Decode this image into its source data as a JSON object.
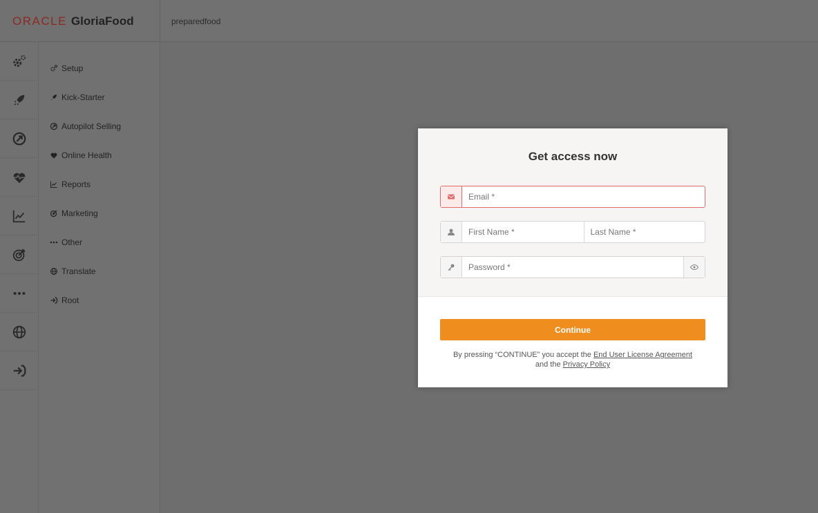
{
  "header": {
    "brand_oracle": "ORACLE",
    "brand_gloria": "GloriaFood",
    "restaurant_name": "preparedfood"
  },
  "icon_rail": [
    {
      "icon": "gears-icon"
    },
    {
      "icon": "rocket-icon"
    },
    {
      "icon": "autopilot-icon"
    },
    {
      "icon": "heart-pulse-icon"
    },
    {
      "icon": "chart-line-icon"
    },
    {
      "icon": "target-icon"
    },
    {
      "icon": "more-dots-icon"
    },
    {
      "icon": "globe-icon"
    },
    {
      "icon": "sign-in-icon"
    }
  ],
  "menu": {
    "items": [
      {
        "label": "Setup",
        "icon": "gears-icon"
      },
      {
        "label": "Kick-Starter",
        "icon": "rocket-icon"
      },
      {
        "label": "Autopilot Selling",
        "icon": "autopilot-icon"
      },
      {
        "label": "Online Health",
        "icon": "heart-pulse-icon"
      },
      {
        "label": "Reports",
        "icon": "chart-line-icon"
      },
      {
        "label": "Marketing",
        "icon": "target-icon"
      },
      {
        "label": "Other",
        "icon": "more-dots-icon"
      },
      {
        "label": "Translate",
        "icon": "globe-icon"
      },
      {
        "label": "Root",
        "icon": "sign-in-icon"
      }
    ]
  },
  "modal": {
    "title": "Get access now",
    "email_placeholder": "Email *",
    "email_value": "",
    "first_name_placeholder": "First Name *",
    "first_name_value": "",
    "last_name_placeholder": "Last Name *",
    "last_name_value": "",
    "password_placeholder": "Password *",
    "password_value": "",
    "continue_label": "Continue",
    "legal_prefix": "By pressing “CONTINUE” you accept the ",
    "eula_link": "End User License Agreement",
    "legal_middle": "and the ",
    "privacy_link": "Privacy Policy"
  },
  "colors": {
    "accent": "#ef8e1f",
    "error": "#e06b6b",
    "brand_oracle": "#8a2a22",
    "overlay": "#6e6e6e"
  }
}
